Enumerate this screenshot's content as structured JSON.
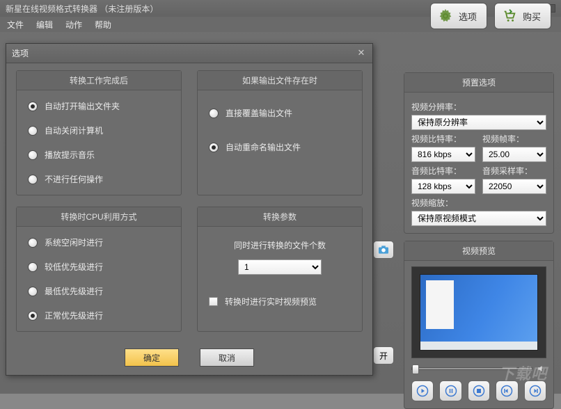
{
  "window": {
    "title": "新星在线视频格式转换器   （未注册版本）"
  },
  "menu": {
    "file": "文件",
    "edit": "编辑",
    "action": "动作",
    "help": "帮助"
  },
  "toolbar": {
    "options": "选项",
    "buy": "购买"
  },
  "rightPanel": {
    "presetTitle": "预置选项",
    "resLabel": "视频分辨率：",
    "resValue": "保持原分辨率",
    "vbLabel": "视频比特率：",
    "vbValue": "816 kbps",
    "vfLabel": "视频帧率：",
    "vfValue": "25.00",
    "abLabel": "音频比特率：",
    "abValue": "128 kbps",
    "asLabel": "音频采样率：",
    "asValue": "22050",
    "vsLabel": "视频缩放：",
    "vsValue": "保持原视频模式",
    "previewTitle": "视频预览"
  },
  "peek": {
    "open": "开"
  },
  "dialog": {
    "title": "选项",
    "groups": {
      "afterDone": {
        "title": "转换工作完成后",
        "opts": [
          "自动打开输出文件夹",
          "自动关闭计算机",
          "播放提示音乐",
          "不进行任何操作"
        ],
        "selected": 0
      },
      "ifExists": {
        "title": "如果输出文件存在时",
        "opts": [
          "直接覆盖输出文件",
          "自动重命名输出文件"
        ],
        "selected": 1
      },
      "cpu": {
        "title": "转换时CPU利用方式",
        "opts": [
          "系统空闲时进行",
          "较低优先级进行",
          "最低优先级进行",
          "正常优先级进行"
        ],
        "selected": 3
      },
      "params": {
        "title": "转换参数",
        "concurrentLabel": "同时进行转换的文件个数",
        "concurrentValue": "1",
        "previewCheck": "转换时进行实时视频预览"
      }
    },
    "ok": "确定",
    "cancel": "取消"
  },
  "watermark": "下载吧"
}
